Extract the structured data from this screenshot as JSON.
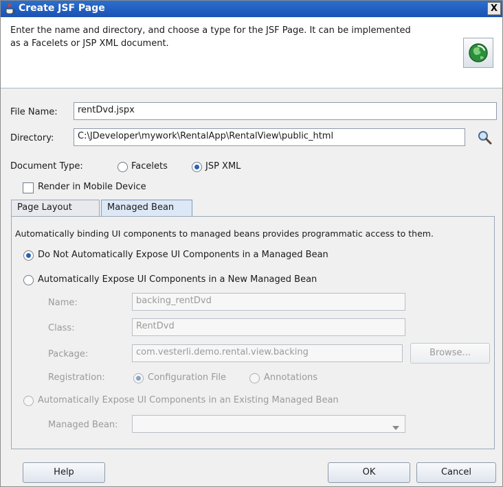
{
  "window": {
    "title": "Create JSF Page",
    "close_label": "X"
  },
  "header": {
    "description": "Enter the name and directory, and choose a type for the JSF Page. It can be implemented as a Facelets or JSP XML document."
  },
  "form": {
    "file_name_label": "File Name:",
    "file_name_value": "rentDvd.jspx",
    "directory_label": "Directory:",
    "directory_value": "C:\\JDeveloper\\mywork\\RentalApp\\RentalView\\public_html",
    "document_type_label": "Document Type:",
    "doc_types": [
      {
        "label": "Facelets",
        "selected": false
      },
      {
        "label": "JSP XML",
        "selected": true
      }
    ],
    "render_mobile_label": "Render in Mobile Device",
    "render_mobile_checked": false
  },
  "tabs": [
    {
      "label": "Page Layout",
      "active": false
    },
    {
      "label": "Managed Bean",
      "active": true
    }
  ],
  "managed_bean": {
    "intro": "Automatically binding UI components to managed beans provides programmatic access to them.",
    "options": [
      {
        "label": "Do Not Automatically Expose UI Components in a Managed Bean",
        "selected": true,
        "enabled": true
      },
      {
        "label": "Automatically Expose UI Components in a New Managed Bean",
        "selected": false,
        "enabled": true
      },
      {
        "label": "Automatically Expose UI Components in an Existing Managed Bean",
        "selected": false,
        "enabled": false
      }
    ],
    "name_label": "Name:",
    "name_value": "backing_rentDvd",
    "class_label": "Class:",
    "class_value": "RentDvd",
    "package_label": "Package:",
    "package_value": "com.vesterli.demo.rental.view.backing",
    "browse_label": "Browse...",
    "registration_label": "Registration:",
    "registration_options": [
      {
        "label": "Configuration File",
        "selected": true
      },
      {
        "label": "Annotations",
        "selected": false
      }
    ],
    "existing_bean_label": "Managed Bean:",
    "existing_bean_value": ""
  },
  "buttons": {
    "help": "Help",
    "ok": "OK",
    "cancel": "Cancel"
  },
  "icons": [
    "coffee-cup-icon",
    "wizard-globe-icon",
    "search-icon",
    "dropdown-arrow-icon"
  ],
  "colors": {
    "titlebar": "#1b52b3",
    "selected_radio": "#2c5fb8"
  }
}
